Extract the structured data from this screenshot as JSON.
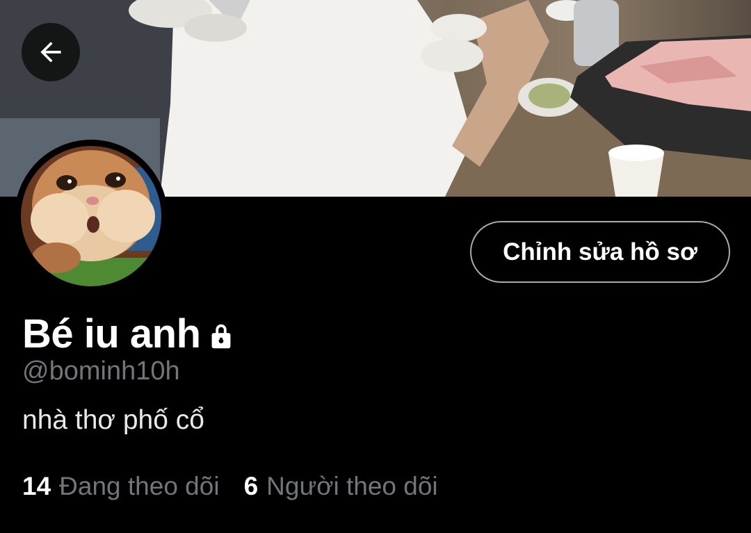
{
  "header": {
    "back_icon": "arrow-left-icon"
  },
  "profile": {
    "display_name": "Bé iu anh",
    "protected_icon": "lock-icon",
    "handle": "@bominh10h",
    "bio": "nhà thơ phố cổ",
    "edit_button_label": "Chỉnh sửa hồ sơ"
  },
  "stats": {
    "following_count": "14",
    "following_label": "Đang theo dõi",
    "followers_count": "6",
    "followers_label": "Người theo dõi"
  },
  "colors": {
    "background": "#000000",
    "primary_text": "#ffffff",
    "secondary_text": "#71767b",
    "button_border": "#a5acb3"
  }
}
